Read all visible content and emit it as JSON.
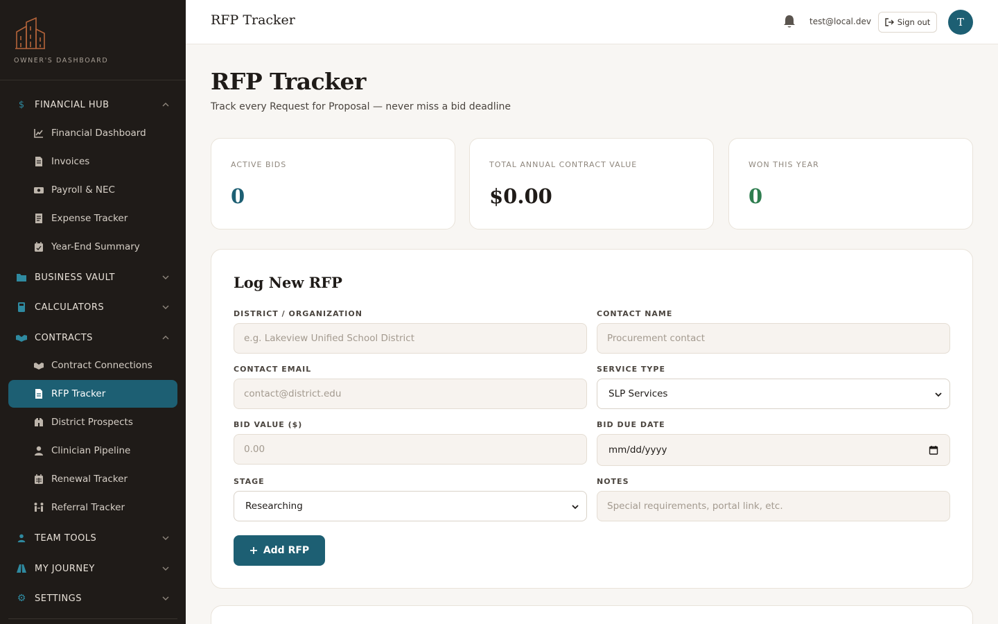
{
  "brand": {
    "label": "OWNER'S DASHBOARD",
    "accent": "#b5643a"
  },
  "sidebar": {
    "sections": [
      {
        "id": "financial",
        "label": "FINANCIAL HUB",
        "icon": "dollar-icon",
        "expanded": true
      },
      {
        "id": "vault",
        "label": "BUSINESS VAULT",
        "icon": "folder-icon",
        "expanded": false
      },
      {
        "id": "calc",
        "label": "CALCULATORS",
        "icon": "calculator-icon",
        "expanded": false
      },
      {
        "id": "contracts",
        "label": "CONTRACTS",
        "icon": "handshake-icon",
        "expanded": true
      },
      {
        "id": "team",
        "label": "TEAM TOOLS",
        "icon": "user-icon",
        "expanded": false
      },
      {
        "id": "journey",
        "label": "MY JOURNEY",
        "icon": "road-icon",
        "expanded": false
      },
      {
        "id": "settings",
        "label": "SETTINGS",
        "icon": "gear-icon",
        "expanded": false
      }
    ],
    "financial_items": [
      {
        "label": "Financial Dashboard",
        "icon": "chart-line-icon"
      },
      {
        "label": "Invoices",
        "icon": "invoice-icon"
      },
      {
        "label": "Payroll & NEC",
        "icon": "money-icon"
      },
      {
        "label": "Expense Tracker",
        "icon": "receipt-icon"
      },
      {
        "label": "Year-End Summary",
        "icon": "calendar-check-icon"
      }
    ],
    "contracts_items": [
      {
        "label": "Contract Connections",
        "icon": "handshake-icon"
      },
      {
        "label": "RFP Tracker",
        "icon": "file-icon",
        "active": true
      },
      {
        "label": "District Prospects",
        "icon": "binoculars-icon"
      },
      {
        "label": "Clinician Pipeline",
        "icon": "user-icon"
      },
      {
        "label": "Renewal Tracker",
        "icon": "calendar-icon"
      },
      {
        "label": "Referral Tracker",
        "icon": "people-arrows-icon"
      }
    ]
  },
  "header": {
    "title": "RFP Tracker",
    "user_email": "test@local.dev",
    "signout_label": "Sign out",
    "avatar_initial": "T"
  },
  "main": {
    "title": "RFP Tracker",
    "subtitle": "Track every Request for Proposal — never miss a bid deadline"
  },
  "stats": [
    {
      "label": "ACTIVE BIDS",
      "value": "0",
      "color": "#1d5f73"
    },
    {
      "label": "TOTAL ANNUAL CONTRACT VALUE",
      "value": "$0.00",
      "color": "#1f1b18"
    },
    {
      "label": "WON THIS YEAR",
      "value": "0",
      "color": "#2e7d4f"
    }
  ],
  "form": {
    "title": "Log New RFP",
    "district": {
      "label": "DISTRICT / ORGANIZATION",
      "placeholder": "e.g. Lakeview Unified School District",
      "value": ""
    },
    "contact_name": {
      "label": "CONTACT NAME",
      "placeholder": "Procurement contact",
      "value": ""
    },
    "contact_email": {
      "label": "CONTACT EMAIL",
      "placeholder": "contact@district.edu",
      "value": ""
    },
    "service_type": {
      "label": "SERVICE TYPE",
      "value": "SLP Services"
    },
    "bid_value": {
      "label": "BID VALUE ($)",
      "placeholder": "0.00",
      "value": ""
    },
    "bid_due": {
      "label": "BID DUE DATE",
      "value": "mm/dd/yyyy"
    },
    "stage": {
      "label": "STAGE",
      "value": "Researching"
    },
    "notes": {
      "label": "NOTES",
      "placeholder": "Special requirements, portal link, etc.",
      "value": ""
    },
    "submit_label": "Add RFP"
  },
  "colors": {
    "primary": "#1d5f73",
    "sidebar_bg": "#1f1b18",
    "page_bg": "#f8f6f3"
  }
}
